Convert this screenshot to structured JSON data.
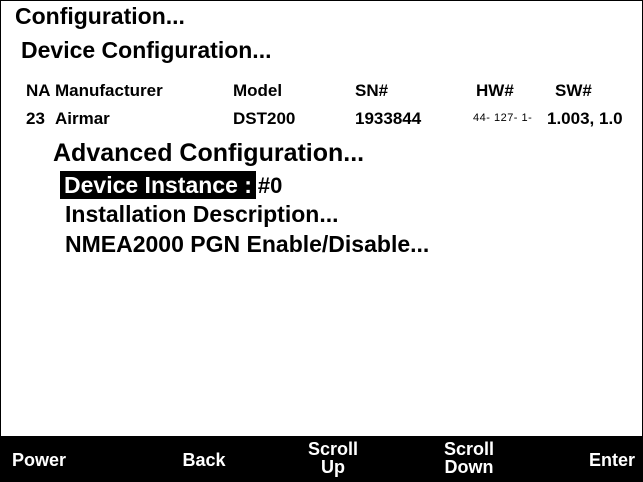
{
  "title": "Configuration...",
  "subtitle": "Device Configuration...",
  "table": {
    "headers": [
      "NA",
      "Manufacturer",
      "Model",
      "SN#",
      "HW#",
      "SW#"
    ],
    "row": [
      "23",
      "Airmar",
      "DST200",
      "1933844",
      "44- 127- 1-",
      "1.003, 1.0"
    ]
  },
  "section_title": "Advanced Configuration...",
  "menu": {
    "selected_label": "Device Instance :",
    "selected_value": "#0",
    "items": [
      "Installation Description...",
      "NMEA2000 PGN Enable/Disable..."
    ]
  },
  "softkeys": {
    "power": "Power",
    "back": "Back",
    "scroll_up": "Scroll Up",
    "scroll_down": "Scroll Down",
    "enter": "Enter"
  }
}
